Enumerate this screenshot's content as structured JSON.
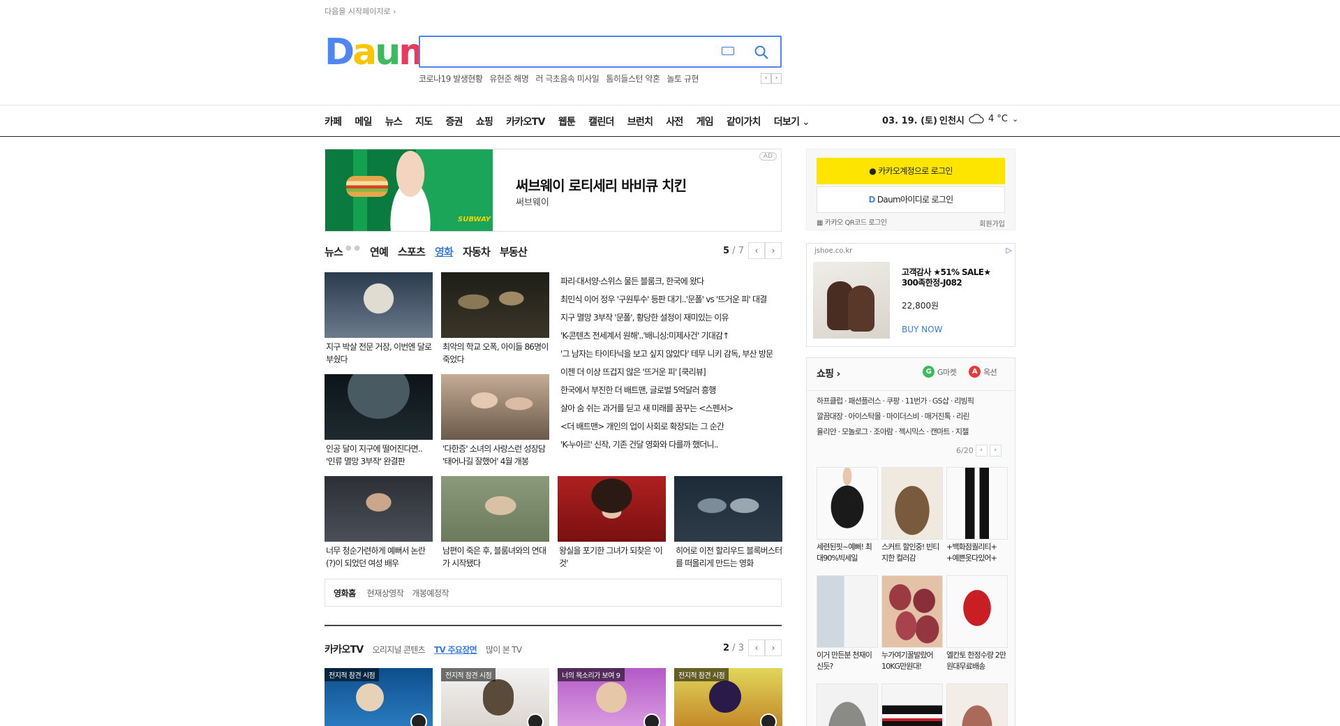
{
  "top": {
    "start_page": "다음을 시작페이지로 ›",
    "logo": [
      "D",
      "a",
      "u",
      "m"
    ],
    "search": {
      "placeholder": "",
      "value": ""
    },
    "trending": [
      "코로나19 발생현황",
      "유현준 해명",
      "러 극초음속 미사일",
      "톰히들스턴 약혼",
      "놀토 규현"
    ]
  },
  "gnb": [
    "카페",
    "메일",
    "뉴스",
    "지도",
    "증권",
    "쇼핑",
    "카카오TV",
    "웹툰",
    "캘린더",
    "브런치",
    "사전",
    "게임",
    "같이가치"
  ],
  "gnb_more": "더보기",
  "status": {
    "date": "03. 19. (토)",
    "city": "인천시",
    "temperature": "4 °C"
  },
  "ad": {
    "title": "써브웨이 로티세리 바비큐 치킨",
    "brand": "써브웨이",
    "mark": "AD",
    "image_text": "SUBWAY"
  },
  "news_tabs": [
    "뉴스",
    "연예",
    "스포츠",
    "영화",
    "자동차",
    "부동산"
  ],
  "news_tab_active": 3,
  "news_pager": {
    "current": "5",
    "total": " / 7"
  },
  "news_thumbs": [
    {
      "caption": "지구 박살 전문 거장, 이번엔 달로 부쉈다",
      "colors": [
        "#6b7b8c",
        "#d9d4c8"
      ]
    },
    {
      "caption": "최악의 학교 오폭, 아이들 86명이 죽었다",
      "colors": [
        "#2a2a22",
        "#8a7756"
      ]
    },
    {
      "caption": "인공 달이 지구에 떨어진다면.. '인류 멸망 3부작' 완결판",
      "colors": [
        "#0c1418",
        "#3b4a52"
      ]
    },
    {
      "caption": "'다한증' 소녀의 사랑스런 성장담 '태어나길 잘했어' 4월 개봉",
      "colors": [
        "#b69c86",
        "#6a5a4a"
      ]
    }
  ],
  "news_headlines": [
    "파리·대서양·스위스 물든 블룸크, 한국에 왔다",
    "최민식 이어 정우 '구원투수' 등판 대기..'문폴' vs '뜨거운 피' 대결",
    "지구 멸망 3부작 '문폴', 황당한 설정이 재미있는 이유",
    "'K-콘텐츠 전세계서 원해'..'배니싱:미제사건' 기대감↑",
    "'그 남자는 타이타닉을 보고 싶지 않았다' 테무 니키 감독, 부산 방문",
    "이젠 더 이상 뜨겁지 않은 '뜨거운 피' [쿡리뷰]",
    "한국에서 부진한 더 배트맨, 글로벌 5억달러 흥행",
    "살아 숨 쉬는 과거를 딛고 새 미래를 꿈꾸는 <스펜서>",
    "<더 배트맨> 개인의 업이 사회로 확장되는 그 순간",
    "'K-누아르' 신작, 기존 건달 영화와 다를까 했더니.."
  ],
  "news_bottom": [
    {
      "caption": "너무 청순가련하게 예뻐서 논란(?)이 되었던 여성 배우",
      "colors": [
        "#2c2f35",
        "#caa78a"
      ]
    },
    {
      "caption": "남편이 죽은 후, 블룸녀와의 연대가 시작됐다",
      "colors": [
        "#8a9a7a",
        "#c9b79e"
      ]
    },
    {
      "caption": "왕실을 포기한 그녀가 되찾은 '이것'",
      "colors": [
        "#b02020",
        "#2b1a14"
      ]
    },
    {
      "caption": "히어로 이전 할리우드 블록버스터를 떠올리게 만드는 영화",
      "colors": [
        "#1d2a38",
        "#7d8c99"
      ]
    }
  ],
  "movie_box": {
    "home": "영화홈",
    "now": "현재상영작",
    "upcoming": "개봉예정작"
  },
  "kakao_tabs": {
    "title": "카카오TV",
    "items": [
      "오리지널 콘텐츠",
      "TV 주요장면",
      "많이 본 TV"
    ],
    "active": 1
  },
  "kakao_pager": {
    "current": "2",
    "total": " / 3"
  },
  "kakao_thumbs": [
    {
      "label": "전지적 참견 시점",
      "colors": [
        "#0d4f8c",
        "#e6d2b8"
      ]
    },
    {
      "label": "전지적 참견 시점",
      "colors": [
        "#f2f2f2",
        "#5a4a3a"
      ]
    },
    {
      "label": "너의 목소리가 보여 9",
      "colors": [
        "#b35ac7",
        "#e6c7a8"
      ]
    },
    {
      "label": "전지적 참견 시점",
      "colors": [
        "#e0d65a",
        "#2a1a4a"
      ]
    }
  ],
  "login": {
    "kakao": "카카오계정으로 로그인",
    "daum": "Daum아이디로 로그인",
    "qr": "카카오 QR코드 로그인",
    "join": "회원가입"
  },
  "right_ad": {
    "domain": "jshoe.co.kr",
    "title": "고객감사 ★51% SALE★ 300족한정-J082",
    "price": "22,800원",
    "cta": "BUY NOW"
  },
  "shopping": {
    "title": "쇼핑 ›",
    "gmarket": "G마켓",
    "auction": "옥션",
    "links": [
      "하프클럽 · 패션플러스 · 쿠팡 · 11번가 · GS샵 · 리빙픽",
      "깔끔대장 · 아이스탁몰 · 마이더스비 · 매거진톡 · 리린",
      "율리안 · 모놀로그 · 조아람 · 젝시믹스 · 캔마트 · 지젤"
    ],
    "pager": "6/20",
    "products": [
      {
        "caption": "세련된핏~예뻐! 최대90%빅세일",
        "colors": [
          "#fafafa",
          "#1a1a1a"
        ]
      },
      {
        "caption": "스커트 할인중! 빈티지한 컬러감",
        "colors": [
          "#efe9e0",
          "#7a5a3c"
        ]
      },
      {
        "caption": "+백화점퀄리티+ +예쁜옷다있어+",
        "colors": [
          "#fafafa",
          "#111111"
        ]
      },
      {
        "caption": "이거 만든분 천재이신듯?",
        "colors": [
          "#cfd8e0",
          "#f4f4f4"
        ]
      },
      {
        "caption": "누가여기꿀발랐어 10KG만원대!",
        "colors": [
          "#9c3a44",
          "#e3c2a8"
        ]
      },
      {
        "caption": "엘칸토 한정수량 2만원대무료배송",
        "colors": [
          "#fafafa",
          "#c81e24"
        ]
      },
      {
        "caption": "",
        "colors": [
          "#f2f2f2",
          "#8a8a86"
        ]
      },
      {
        "caption": "",
        "colors": [
          "#f5f5f5",
          "#111111"
        ]
      },
      {
        "caption": "",
        "colors": [
          "#f3ede8",
          "#a96a5a"
        ]
      }
    ]
  },
  "colors": {
    "accent": "#3b7ddd",
    "kakao_yellow": "#fee500"
  }
}
